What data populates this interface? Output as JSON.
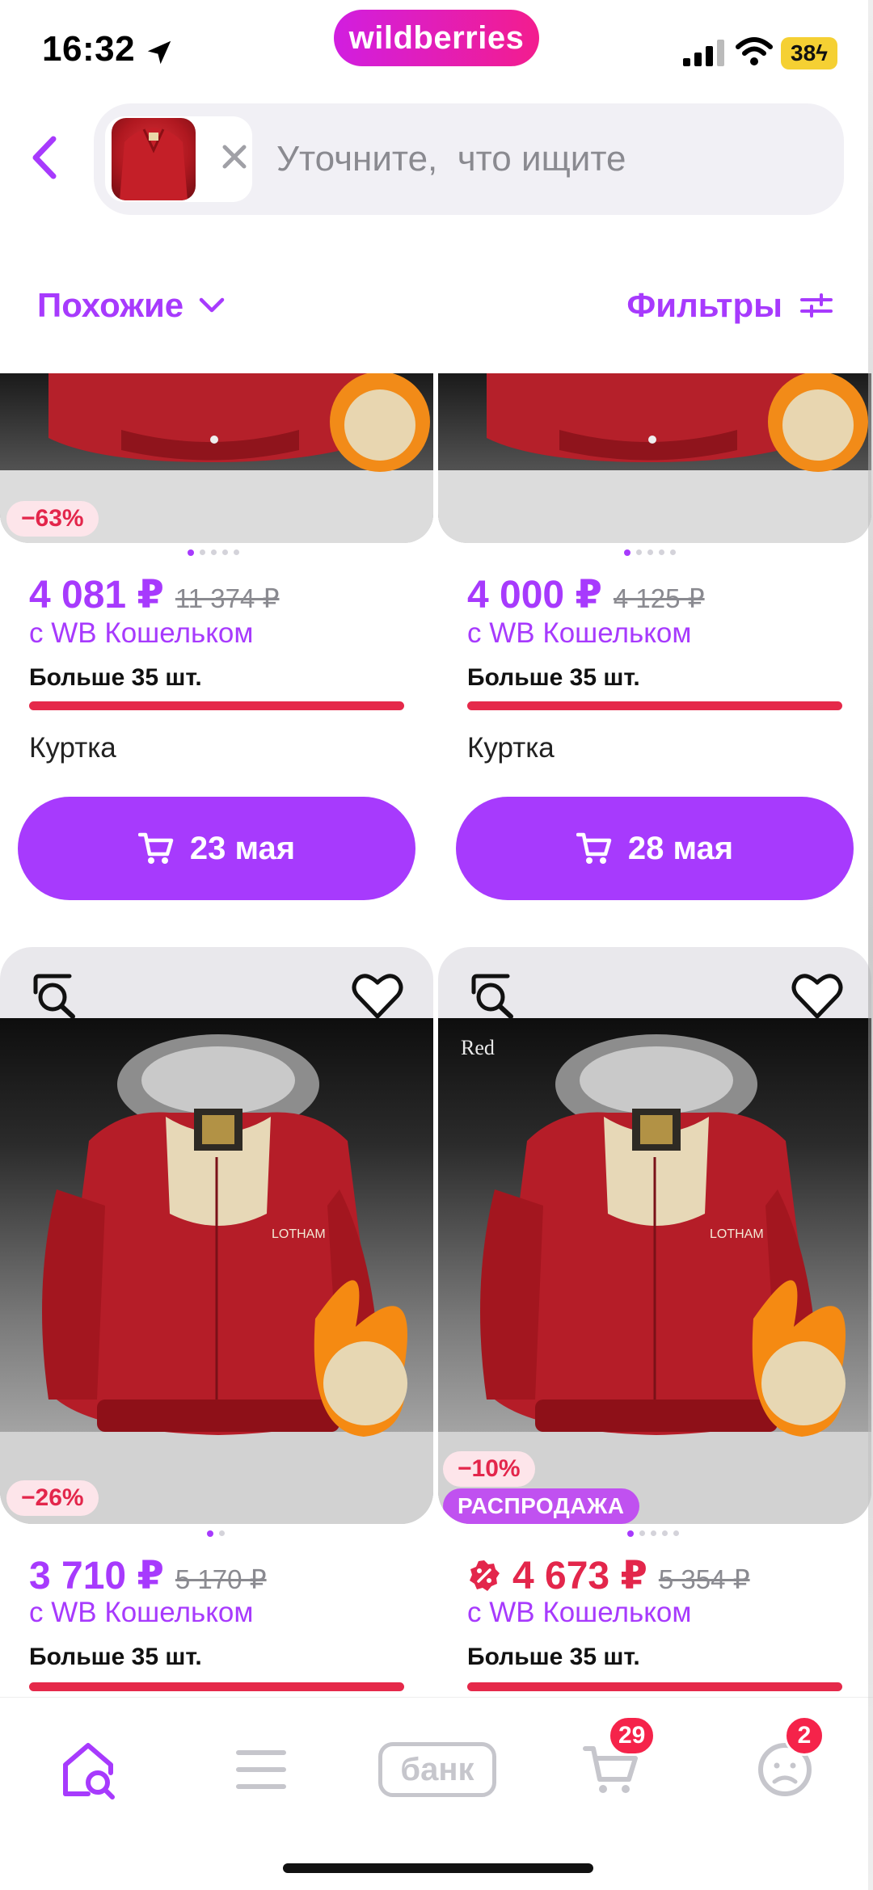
{
  "status": {
    "time": "16:32",
    "brand": "wildberries",
    "battery": "38"
  },
  "search": {
    "placeholder": "Уточните,  что ищите"
  },
  "toolbar": {
    "similar_label": "Похожие",
    "filters_label": "Фильтры"
  },
  "products": [
    {
      "discount": "−63%",
      "price": "4 081 ₽",
      "old_price": "11 374 ₽",
      "wallet": "с WB Кошельком",
      "stock": "Больше 35 шт.",
      "title": "Куртка",
      "delivery": "23 мая"
    },
    {
      "price": "4 000 ₽",
      "old_price": "4 125 ₽",
      "wallet": "с WB Кошельком",
      "stock": "Больше 35 шт.",
      "title": "Куртка",
      "delivery": "28 мая"
    },
    {
      "discount": "−26%",
      "price": "3 710 ₽",
      "old_price": "5 170 ₽",
      "wallet": "с WB Кошельком",
      "stock": "Больше 35 шт."
    },
    {
      "discount": "−10%",
      "sale": "РАСПРОДАЖА",
      "image_label": "Red",
      "price": "4 673 ₽",
      "old_price": "5 354 ₽",
      "wallet": "с WB Кошельком",
      "stock": "Больше 35 шт."
    }
  ],
  "nav": {
    "items": [
      "home-search",
      "catalog",
      "bank",
      "cart",
      "profile"
    ],
    "bank_label": "банк",
    "cart_badge": "29",
    "profile_badge": "2"
  },
  "colors": {
    "accent": "#a73afd",
    "discount": "#e3264b",
    "sale": "#c051f0"
  }
}
